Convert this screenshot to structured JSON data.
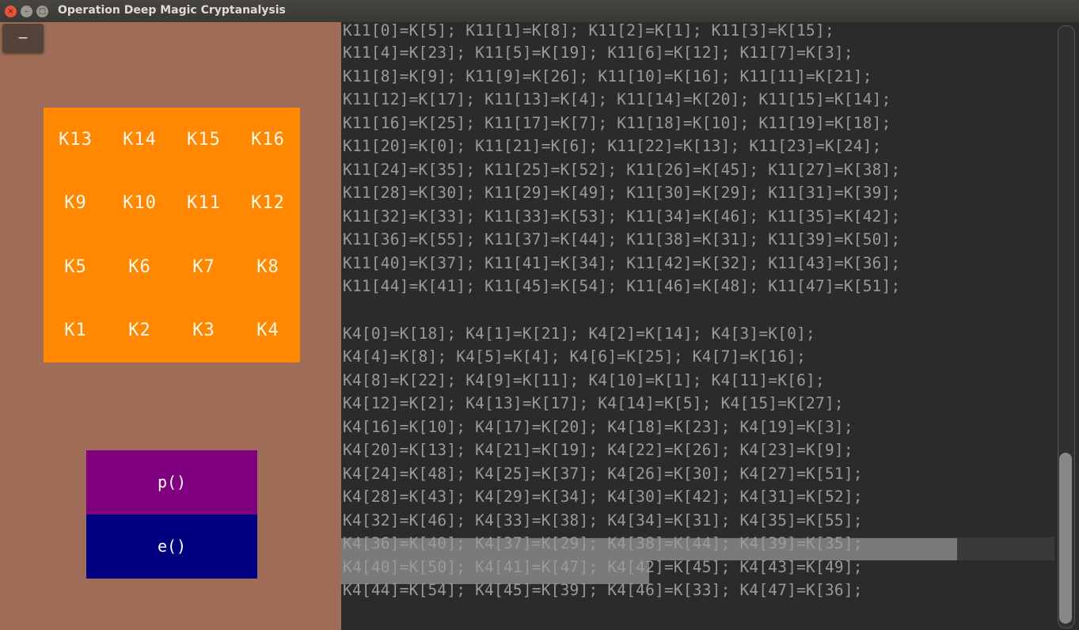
{
  "window": {
    "title": "Operation Deep Magic Cryptanalysis",
    "controls": {
      "close": "×",
      "minimize": "–",
      "maximize": "▢"
    }
  },
  "left_panel": {
    "minimize_label": "–",
    "keys": [
      "K13",
      "K14",
      "K15",
      "K16",
      "K9",
      "K10",
      "K11",
      "K12",
      "K5",
      "K6",
      "K7",
      "K8",
      "K1",
      "K2",
      "K3",
      "K4"
    ],
    "p_button": "p()",
    "e_button": "e()"
  },
  "text_lines": [
    "K11[0]=K[5]; K11[1]=K[8]; K11[2]=K[1]; K11[3]=K[15];",
    "K11[4]=K[23]; K11[5]=K[19]; K11[6]=K[12]; K11[7]=K[3];",
    "K11[8]=K[9]; K11[9]=K[26]; K11[10]=K[16]; K11[11]=K[21];",
    "K11[12]=K[17]; K11[13]=K[4]; K11[14]=K[20]; K11[15]=K[14];",
    "K11[16]=K[25]; K11[17]=K[7]; K11[18]=K[10]; K11[19]=K[18];",
    "K11[20]=K[0]; K11[21]=K[6]; K11[22]=K[13]; K11[23]=K[24];",
    "K11[24]=K[35]; K11[25]=K[52]; K11[26]=K[45]; K11[27]=K[38];",
    "K11[28]=K[30]; K11[29]=K[49]; K11[30]=K[29]; K11[31]=K[39];",
    "K11[32]=K[33]; K11[33]=K[53]; K11[34]=K[46]; K11[35]=K[42];",
    "K11[36]=K[55]; K11[37]=K[44]; K11[38]=K[31]; K11[39]=K[50];",
    "K11[40]=K[37]; K11[41]=K[34]; K11[42]=K[32]; K11[43]=K[36];",
    "K11[44]=K[41]; K11[45]=K[54]; K11[46]=K[48]; K11[47]=K[51];",
    "",
    "K4[0]=K[18]; K4[1]=K[21]; K4[2]=K[14]; K4[3]=K[0];",
    "K4[4]=K[8]; K4[5]=K[4]; K4[6]=K[25]; K4[7]=K[16];",
    "K4[8]=K[22]; K4[9]=K[11]; K4[10]=K[1]; K4[11]=K[6];",
    "K4[12]=K[2]; K4[13]=K[17]; K4[14]=K[5]; K4[15]=K[27];",
    "K4[16]=K[10]; K4[17]=K[20]; K4[18]=K[23]; K4[19]=K[3];",
    "K4[20]=K[13]; K4[21]=K[19]; K4[22]=K[26]; K4[23]=K[9];",
    "K4[24]=K[48]; K4[25]=K[37]; K4[26]=K[30]; K4[27]=K[51];",
    "K4[28]=K[43]; K4[29]=K[34]; K4[30]=K[42]; K4[31]=K[52];",
    "K4[32]=K[46]; K4[33]=K[38]; K4[34]=K[31]; K4[35]=K[55];",
    "K4[36]=K[40]; K4[37]=K[29]; K4[38]=K[44]; K4[39]=K[35];",
    "K4[40]=K[50]; K4[41]=K[47]; K4[42]=K[45]; K4[43]=K[49];",
    "K4[44]=K[54]; K4[45]=K[39]; K4[46]=K[33]; K4[47]=K[36];"
  ],
  "colors": {
    "keypad": "#ff8800",
    "p_button": "#800080",
    "e_button": "#000080",
    "panel": "#9e6c57",
    "editor_bg": "#2b2b2b",
    "text": "#9a9a9a"
  }
}
